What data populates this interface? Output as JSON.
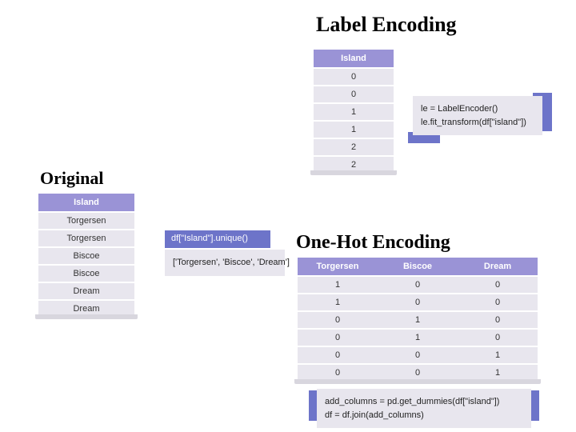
{
  "headings": {
    "original": "Original",
    "label": "Label Encoding",
    "onehot": "One-Hot Encoding"
  },
  "original_table": {
    "header": "Island",
    "rows": [
      "Torgersen",
      "Torgersen",
      "Biscoe",
      "Biscoe",
      "Dream",
      "Dream"
    ]
  },
  "original_code": {
    "call": "df[\"Island\"].unique()",
    "output": "['Torgersen', 'Biscoe', 'Dream']"
  },
  "label_table": {
    "header": "Island",
    "rows": [
      "0",
      "0",
      "1",
      "1",
      "2",
      "2"
    ]
  },
  "label_code": {
    "line1": "le = LabelEncoder()",
    "line2": "le.fit_transform(df[\"island\"])"
  },
  "onehot_table": {
    "headers": [
      "Torgersen",
      "Biscoe",
      "Dream"
    ],
    "rows": [
      [
        "1",
        "0",
        "0"
      ],
      [
        "1",
        "0",
        "0"
      ],
      [
        "0",
        "1",
        "0"
      ],
      [
        "0",
        "1",
        "0"
      ],
      [
        "0",
        "0",
        "1"
      ],
      [
        "0",
        "0",
        "1"
      ]
    ]
  },
  "onehot_code": {
    "line1": "add_columns = pd.get_dummies(df[\"island\"])",
    "line2": "df = df.join(add_columns)"
  }
}
